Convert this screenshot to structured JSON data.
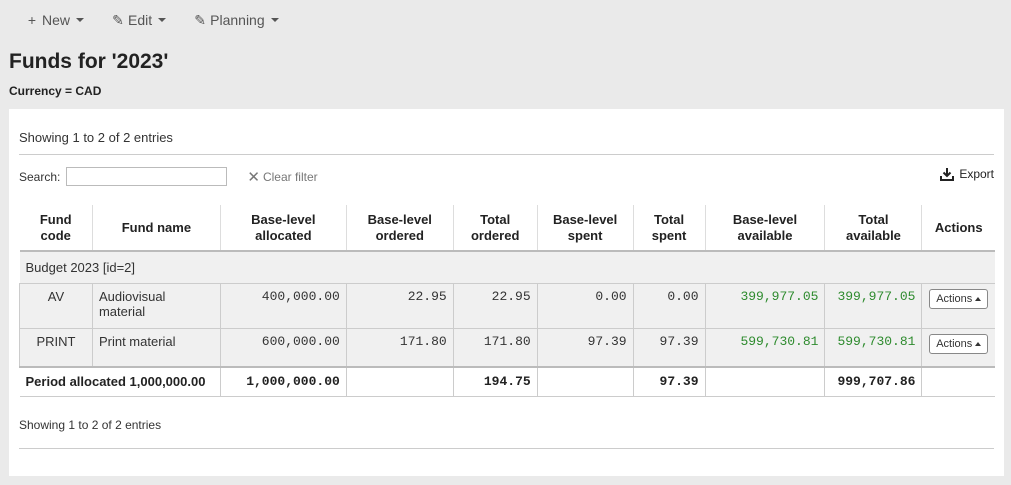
{
  "toolbar": {
    "new_label": "New",
    "edit_label": "Edit",
    "planning_label": "Planning"
  },
  "page_title": "Funds for '2023'",
  "currency_label": "Currency = CAD",
  "info_top": "Showing 1 to 2 of 2 entries",
  "search": {
    "label": "Search:",
    "placeholder": "",
    "value": ""
  },
  "clear_filter_label": "Clear filter",
  "export_label": "Export",
  "columns": [
    "Fund code",
    "Fund name",
    "Base-level allocated",
    "Base-level ordered",
    "Total ordered",
    "Base-level spent",
    "Total spent",
    "Base-level available",
    "Total available",
    "Actions"
  ],
  "group_label": "Budget 2023 [id=2]",
  "rows": [
    {
      "code": "AV",
      "name": "Audiovisual material",
      "base_allocated": "400,000.00",
      "base_ordered": "22.95",
      "total_ordered": "22.95",
      "base_spent": "0.00",
      "total_spent": "0.00",
      "base_available": "399,977.05",
      "total_available": "399,977.05",
      "actions_label": "Actions"
    },
    {
      "code": "PRINT",
      "name": "Print material",
      "base_allocated": "600,000.00",
      "base_ordered": "171.80",
      "total_ordered": "171.80",
      "base_spent": "97.39",
      "total_spent": "97.39",
      "base_available": "599,730.81",
      "total_available": "599,730.81",
      "actions_label": "Actions"
    }
  ],
  "footer": {
    "label": "Period allocated 1,000,000.00",
    "base_allocated": "1,000,000.00",
    "total_ordered": "194.75",
    "total_spent": "97.39",
    "total_available": "999,707.86"
  },
  "info_bottom": "Showing 1 to 2 of 2 entries",
  "colors": {
    "available_green": "#2e8b2e"
  }
}
